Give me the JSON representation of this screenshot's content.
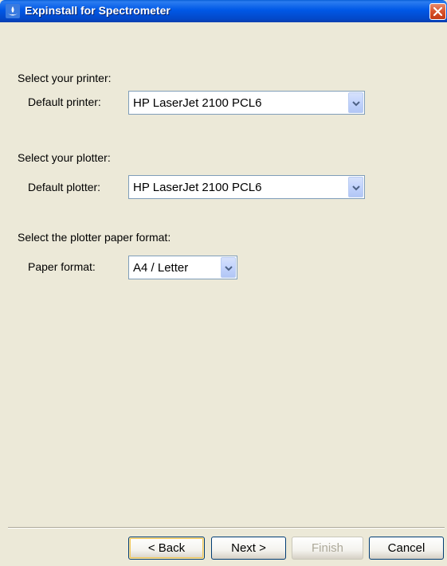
{
  "window": {
    "title": "Expinstall for Spectrometer"
  },
  "printer": {
    "section_label": "Select your printer:",
    "field_label": "Default printer:",
    "selected": "HP LaserJet 2100 PCL6"
  },
  "plotter": {
    "section_label": "Select your plotter:",
    "field_label": "Default plotter:",
    "selected": "HP LaserJet 2100 PCL6"
  },
  "paper": {
    "section_label": "Select the plotter paper format:",
    "field_label": "Paper format:",
    "selected": "A4 / Letter"
  },
  "buttons": {
    "back": "< Back",
    "next": "Next >",
    "finish": "Finish",
    "cancel": "Cancel"
  },
  "colors": {
    "titlebar": "#0058e6",
    "dialog_bg": "#ece9d8",
    "close_button": "#d8532c"
  }
}
